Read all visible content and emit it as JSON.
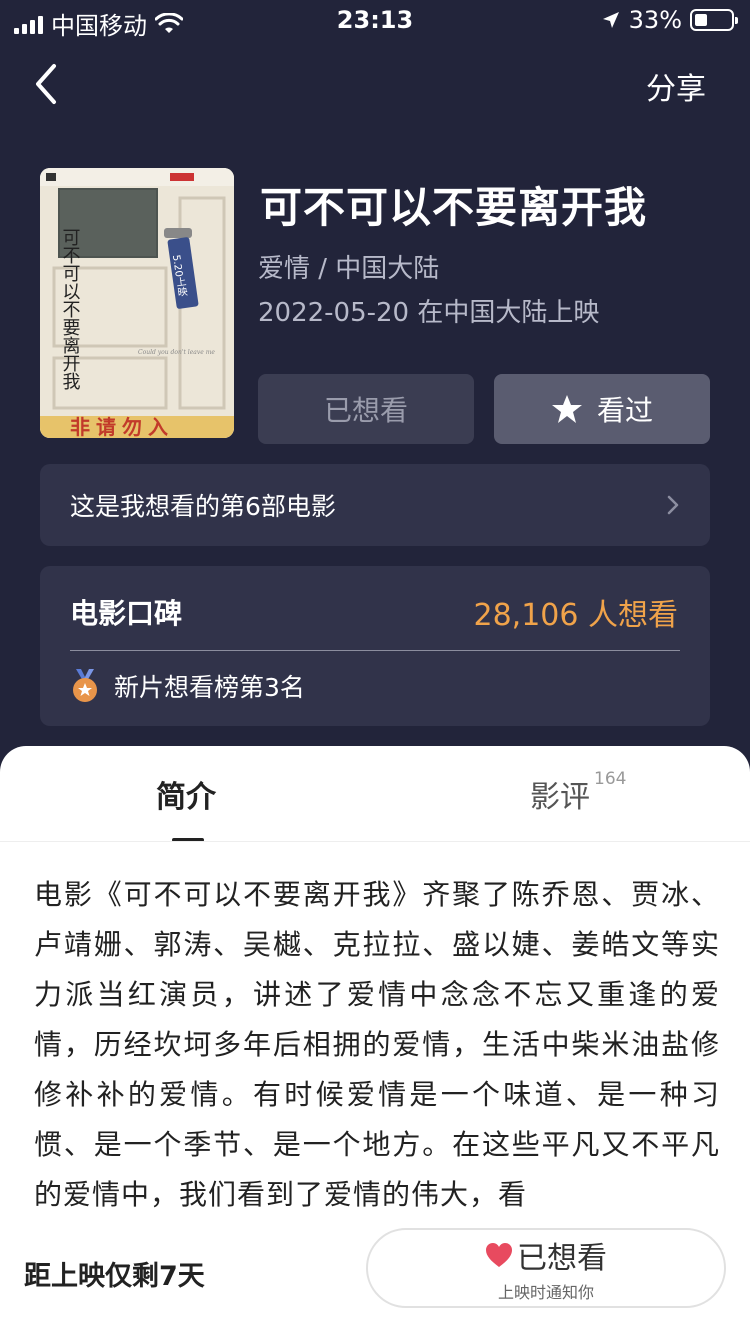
{
  "status_bar": {
    "carrier": "中国移动",
    "time": "23:13",
    "battery": "33%"
  },
  "nav": {
    "share_label": "分享"
  },
  "movie": {
    "title": "可不可以不要离开我",
    "genre": "爱情 / 中国大陆",
    "release": "2022-05-20 在中国大陆上映",
    "poster": {
      "title_text": "可不可以不要离开我",
      "tag_text": "5.20上映",
      "banner_text": "非请勿入",
      "english_text": "Could you don't leave me"
    }
  },
  "actions": {
    "want_label": "已想看",
    "seen_label": "看过"
  },
  "count_row": {
    "text": "这是我想看的第6部电影"
  },
  "reputation": {
    "title": "电影口碑",
    "want_count": "28,106 人想看",
    "rank": "新片想看榜第3名"
  },
  "tabs": {
    "intro_label": "简介",
    "review_label": "影评",
    "review_count": "164"
  },
  "synopsis": "电影《可不可以不要离开我》齐聚了陈乔恩、贾冰、卢靖姗、郭涛、吴樾、克拉拉、盛以婕、姜皓文等实力派当红演员，讲述了爱情中念念不忘又重逢的爱情，历经坎坷多年后相拥的爱情，生活中柴米油盐修修补补的爱情。有时候爱情是一个味道、是一种习惯、是一个季节、是一个地方。在这些平凡又不平凡的爱情中，我们看到了爱情的伟大，看",
  "bottom": {
    "days_left": "距上映仅剩7天",
    "wish_label": "已想看",
    "wish_sub": "上映时通知你"
  },
  "colors": {
    "background": "#22243a",
    "card": "#31334a",
    "accent_orange": "#f0a34a",
    "heart": "#e84a5f"
  }
}
